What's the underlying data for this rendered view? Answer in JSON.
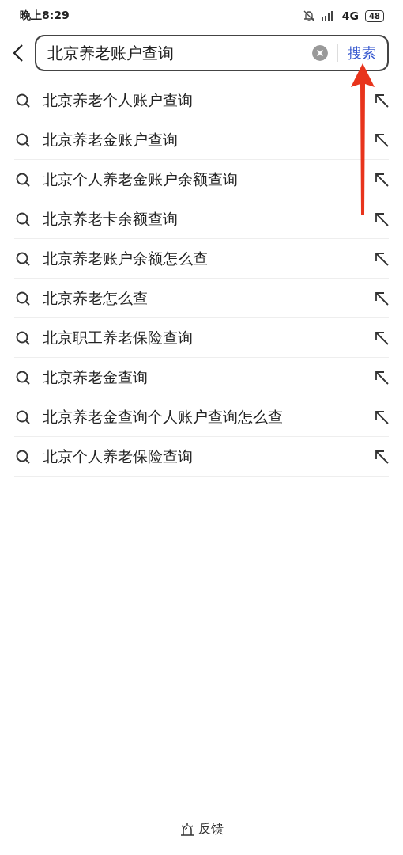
{
  "status_bar": {
    "time": "晚上8:29",
    "network": "4G",
    "battery": "48"
  },
  "search": {
    "value": "北京养老账户查询",
    "button": "搜索"
  },
  "suggestions": [
    {
      "text": "北京养老个人账户查询"
    },
    {
      "text": "北京养老金账户查询"
    },
    {
      "text": "北京个人养老金账户余额查询"
    },
    {
      "text": "北京养老卡余额查询"
    },
    {
      "text": "北京养老账户余额怎么查"
    },
    {
      "text": "北京养老怎么查"
    },
    {
      "text": "北京职工养老保险查询"
    },
    {
      "text": "北京养老金查询"
    },
    {
      "text": "北京养老金查询个人账户查询怎么查"
    },
    {
      "text": "北京个人养老保险查询"
    }
  ],
  "feedback": {
    "label": "反馈"
  }
}
